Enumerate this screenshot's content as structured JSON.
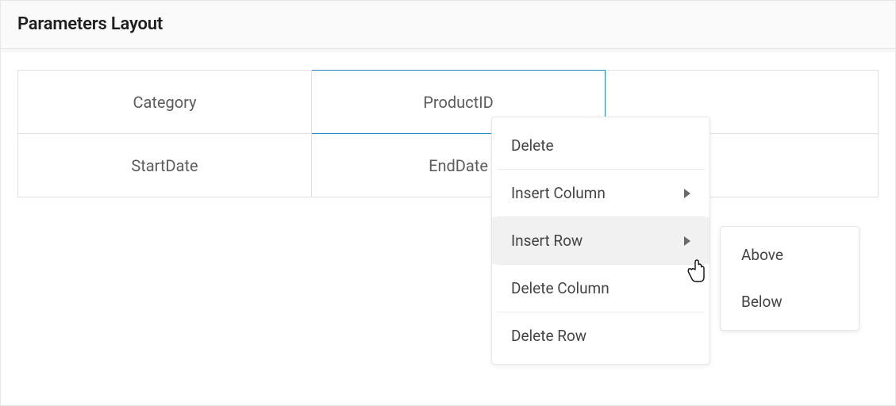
{
  "header": {
    "title": "Parameters Layout"
  },
  "grid": {
    "rows": [
      {
        "cells": [
          "Category",
          "ProductID",
          ""
        ]
      },
      {
        "cells": [
          "StartDate",
          "EndDate",
          ""
        ]
      }
    ]
  },
  "contextMenu": {
    "delete": "Delete",
    "insertColumn": "Insert Column",
    "insertRow": "Insert Row",
    "deleteColumn": "Delete Column",
    "deleteRow": "Delete Row"
  },
  "submenu": {
    "above": "Above",
    "below": "Below"
  }
}
